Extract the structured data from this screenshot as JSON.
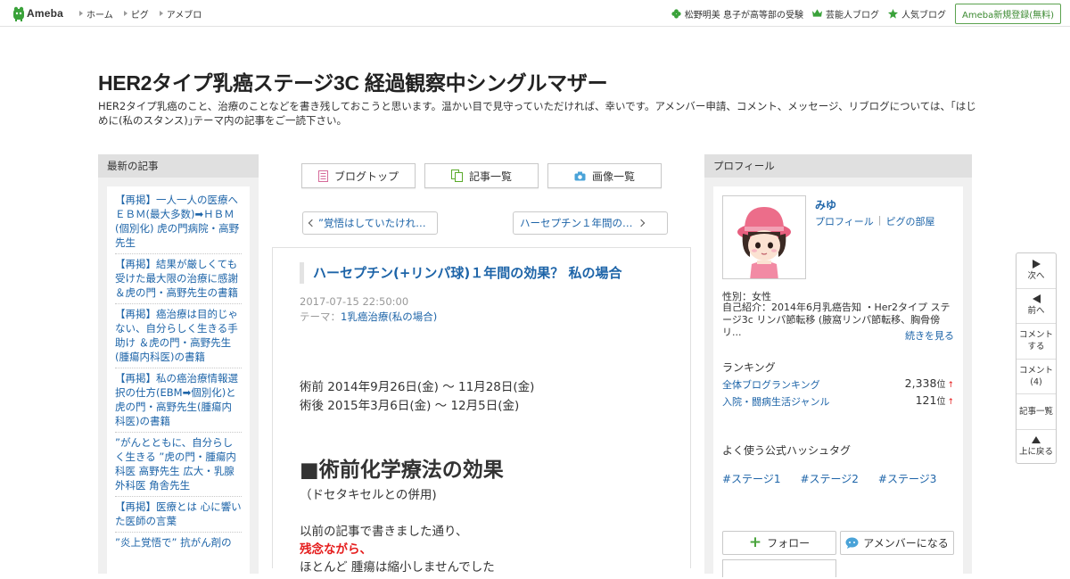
{
  "topbar": {
    "logo_text": "Ameba",
    "nav": [
      {
        "label": "ホーム"
      },
      {
        "label": "ピグ"
      },
      {
        "label": "アメブロ"
      }
    ],
    "right_links": [
      {
        "label": "松野明美 息子が高等部の受験",
        "icon": "clover-icon"
      },
      {
        "label": "芸能人ブログ",
        "icon": "crown-icon"
      },
      {
        "label": "人気ブログ",
        "icon": "star-icon"
      }
    ],
    "register_label": "Ameba新規登録(無料)"
  },
  "blog": {
    "title": "HER2タイプ乳癌ステージ3C 経過観察中シングルマザー",
    "description": "HER2タイプ乳癌のこと、治療のことなどを書き残しておこうと思います。温かい目で見守っていただければ、幸いです。アメンバー申請、コメント、メッセージ、リブログについては、｢はじめに(私のスタンス)｣テーマ内の記事をご一読下さい。"
  },
  "left_column": {
    "heading": "最新の記事",
    "articles": [
      {
        "title": "【再掲】一人一人の医療へ ＥＢＭ(最大多数)➡ＨＢＭ(個別化) 虎の門病院・高野先生"
      },
      {
        "title": "【再掲】結果が厳しくても受けた最大限の治療に感謝 ＆虎の門・高野先生の書籍"
      },
      {
        "title": "【再掲】癌治療は目的じゃない、自分らしく生きる手助け ＆虎の門・高野先生(腫瘍内科医)の書籍"
      },
      {
        "title": "【再掲】私の癌治療情報選択の仕方(EBM➡個別化)と虎の門・高野先生(腫瘍内科医)の書籍"
      },
      {
        "title": "”がんとともに、自分らしく生きる ”虎の門・腫瘍内科医 高野先生 広大・乳腺外科医 角舎先生"
      },
      {
        "title": "【再掲】医療とは 心に響いた医師の言葉"
      },
      {
        "title": "”炎上覚悟で” 抗がん剤の"
      }
    ]
  },
  "main": {
    "buttons": [
      {
        "label": "ブログトップ",
        "icon": "document-icon"
      },
      {
        "label": "記事一覧",
        "icon": "copy-icon"
      },
      {
        "label": "画像一覧",
        "icon": "camera-icon"
      }
    ],
    "prev_label": "”覚悟はしていたけれ…",
    "next_label": "ハーセプチン１年間の…",
    "entry": {
      "title": "ハーセプチン(+リンパ球)１年間の効果？ 私の場合",
      "date": "2017-07-15 22:50:00",
      "theme_prefix": "テーマ：",
      "theme": "1乳癌治療(私の場合)",
      "lines": [
        "術前  2014年9月26日(金)  ～ 11月28日(金)",
        "術後  2015年3月6日(金) ～ 12月5日(金)"
      ],
      "heading": "■術前化学療法の効果",
      "subheading": "（ドセタキセルとの併用)",
      "para1": "以前の記事で書きました通り、",
      "red_text": "残念ながら、",
      "para2": "ほとんど   腫瘍は縮小しませんでした"
    }
  },
  "right_column": {
    "heading": "プロフィール",
    "name": "みゆ",
    "links": [
      "プロフィール",
      "ピグの部屋"
    ],
    "gender": "性別：女性",
    "intro": "自己紹介：2014年6月乳癌告知 ・Her2タイプ ステージ3c リンパ節転移 (腋窩リンパ節転移、胸骨傍リ...",
    "more": "続きを見る",
    "ranking_heading": "ランキング",
    "rankings": [
      {
        "name": "全体ブログランキング",
        "value": "2,338",
        "unit": "位",
        "trend": "↑"
      },
      {
        "name": "入院・闘病生活ジャンル",
        "value": "121",
        "unit": "位",
        "trend": "↑"
      }
    ],
    "tags_heading": "よく使う公式ハッシュタグ",
    "tags": [
      "#ステージ1",
      "#ステージ2",
      "#ステージ3"
    ],
    "follow_label": "フォロー",
    "member_label": "アメンバーになる"
  },
  "side_nav": {
    "next": "次へ",
    "prev": "前へ",
    "comment_1": "コメント",
    "comment_2": "する",
    "comments_1": "コメント",
    "comments_2": "(4)",
    "list": "記事一覧",
    "top": "上に戻る"
  },
  "colors": {
    "link": "#1d64a8",
    "accent_green": "#3c8a31",
    "red": "#e51d1d",
    "column_bg": "#f0f0f0"
  }
}
